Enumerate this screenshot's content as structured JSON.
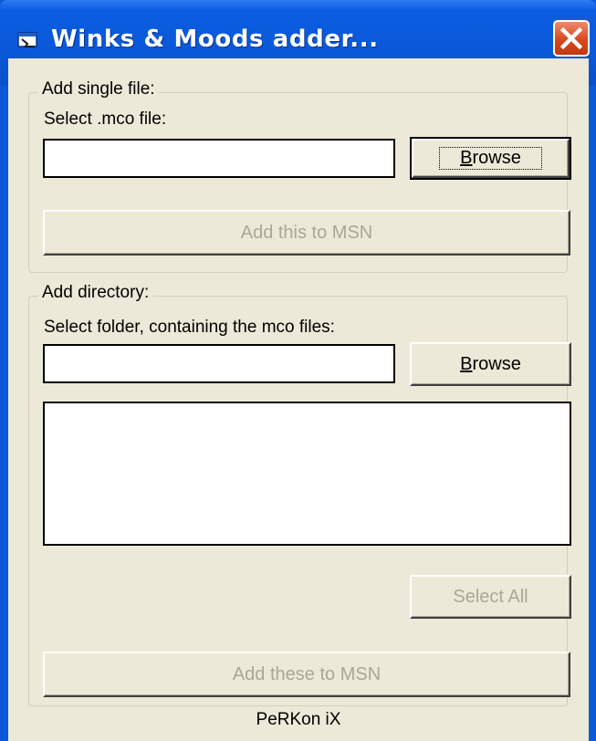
{
  "window": {
    "title": "Winks & Moods adder..."
  },
  "single": {
    "legend": "Add single file:",
    "label": "Select .mco file:",
    "file_value": "",
    "browse_label": "Browse",
    "browse_mnemonic": "B",
    "add_label": "Add this to MSN"
  },
  "directory": {
    "legend": "Add directory:",
    "label": "Select folder, containing the mco files:",
    "folder_value": "",
    "browse_label": "Browse",
    "browse_mnemonic": "B",
    "select_all_label": "Select All",
    "add_label": "Add these to MSN"
  },
  "footer": {
    "text": "PeRKon iX"
  },
  "colors": {
    "titlebar": "#0a58d9",
    "close_button": "#d8481f",
    "dialog_bg": "#ece9d8",
    "disabled_text": "#a8a799"
  }
}
